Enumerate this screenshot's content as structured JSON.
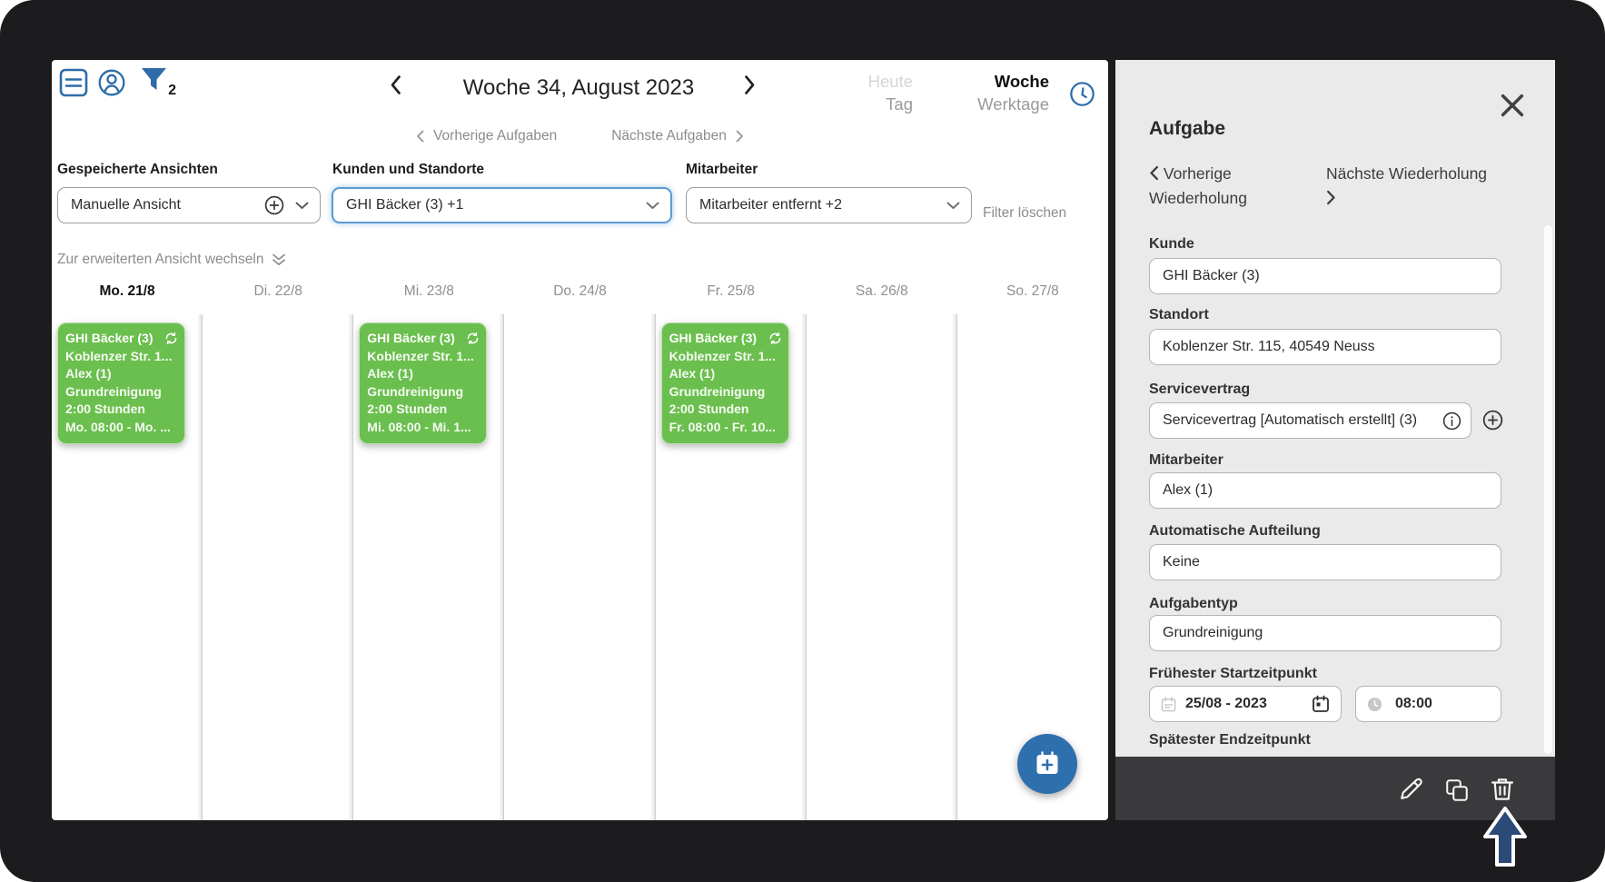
{
  "toolbar": {
    "week_title": "Woche 34, August 2023",
    "filter_count": "2",
    "today_label": "Heute",
    "day_label": "Tag",
    "week_label": "Woche",
    "workdays_label": "Werktage"
  },
  "task_nav": {
    "prev_label": "Vorherige Aufgaben",
    "next_label": "Nächste Aufgaben"
  },
  "filters": {
    "saved_views_label": "Gespeicherte Ansichten",
    "saved_views_value": "Manuelle Ansicht",
    "customers_label": "Kunden und Standorte",
    "customers_value": "GHI Bäcker (3) +1",
    "employees_label": "Mitarbeiter",
    "employees_value": "Mitarbeiter entfernt +2",
    "clear_label": "Filter löschen",
    "advanced_label": "Zur erweiterten Ansicht wechseln"
  },
  "calendar": {
    "days": [
      {
        "label": "Mo. 21/8",
        "active": true
      },
      {
        "label": "Di. 22/8",
        "active": false
      },
      {
        "label": "Mi. 23/8",
        "active": false
      },
      {
        "label": "Do. 24/8",
        "active": false
      },
      {
        "label": "Fr. 25/8",
        "active": false
      },
      {
        "label": "Sa. 26/8",
        "active": false
      },
      {
        "label": "So. 27/8",
        "active": false
      }
    ],
    "events": [
      {
        "day": "Mo",
        "title": "GHI Bäcker (3)",
        "lines": [
          "Koblenzer Str. 1...",
          "Alex (1)",
          "Grundreinigung",
          "2:00 Stunden",
          "Mo. 08:00 - Mo. ..."
        ]
      },
      {
        "day": "Mi",
        "title": "GHI Bäcker (3)",
        "lines": [
          "Koblenzer Str. 1...",
          "Alex (1)",
          "Grundreinigung",
          "2:00 Stunden",
          "Mi. 08:00 - Mi. 1..."
        ]
      },
      {
        "day": "Fr",
        "title": "GHI Bäcker (3)",
        "lines": [
          "Koblenzer Str. 1...",
          "Alex (1)",
          "Grundreinigung",
          "2:00 Stunden",
          "Fr. 08:00 - Fr. 10..."
        ]
      }
    ]
  },
  "panel": {
    "title": "Aufgabe",
    "prev_repeat_label": "Vorherige Wiederholung",
    "next_repeat_label": "Nächste Wiederholung",
    "kunde_label": "Kunde",
    "kunde_value": "GHI Bäcker (3)",
    "standort_label": "Standort",
    "standort_value": "Koblenzer Str. 115, 40549 Neuss",
    "servicevertrag_label": "Servicevertrag",
    "servicevertrag_value": "Servicevertrag [Automatisch erstellt] (3)",
    "mitarbeiter_label": "Mitarbeiter",
    "mitarbeiter_value": "Alex (1)",
    "aufteilung_label": "Automatische Aufteilung",
    "aufteilung_value": "Keine",
    "aufgabentyp_label": "Aufgabentyp",
    "aufgabentyp_value": "Grundreinigung",
    "start_label": "Frühester Startzeitpunkt",
    "start_date": "25/08 - 2023",
    "start_time": "08:00",
    "end_label": "Spätester Endzeitpunkt"
  },
  "icons": {
    "menu": "boxed-list",
    "user": "person-circle",
    "filter": "funnel-filled",
    "week_clock": "clock-outline",
    "recurrence": "sync-arrows",
    "add": "plus-circle",
    "dropdown": "chevron-down",
    "advanced": "double-chevron-down",
    "info": "info-circle",
    "date": "calendar",
    "time": "clock",
    "fab": "calendar-plus",
    "edit": "pencil",
    "duplicate": "copy",
    "delete": "trash",
    "close": "x",
    "cursor": "arrow-up-cursor"
  },
  "colors": {
    "accent_blue": "#2d6ca8",
    "event_green": "#6bbf4e",
    "focus_blue": "#5b9bd5",
    "panel_bg": "#eaeaea",
    "action_bar_bg": "#3a3a3c",
    "frame_bg": "#1c1c1e",
    "cursor_blue": "#2b4a77"
  }
}
